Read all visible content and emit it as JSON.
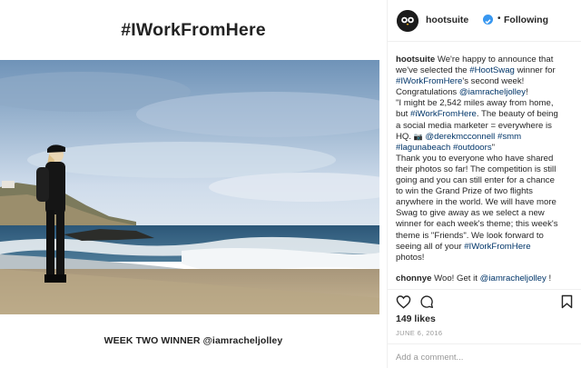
{
  "post_image": {
    "headline": "#IWorkFromHere",
    "caption_bottom": "WEEK TWO  WINNER @iamracheljolley"
  },
  "header": {
    "author": "hootsuite",
    "separator": "•",
    "following": "Following"
  },
  "caption": {
    "username": "hootsuite",
    "l1": "We're happy to announce that",
    "l2a": "we've selected the ",
    "l2tag": "#HootSwag",
    "l2b": " winner for",
    "l3tag": "#IWorkFromHere",
    "l3b": "'s second week!",
    "l4a": "Congratulations ",
    "l4tag": "@iamracheljolley",
    "l4b": "!",
    "l5": "\"I might be 2,542 miles away from home,",
    "l6a": "but ",
    "l6tag": "#iWorkFromHere",
    "l6b": ". The beauty of being",
    "l7": "a social media marketer = everywhere is",
    "l8a": "HQ. ",
    "l8emoji": "📷",
    "l8tag1": "@derekmcconnell",
    "l8tag2": "#smm",
    "l9tag1": "#lagunabeach",
    "l9tag2": "#outdoors",
    "l9b": "\"",
    "l10": "Thank you to everyone who have shared",
    "l11": "their photos so far! The competition is still",
    "l12": "going and you can still enter for a chance",
    "l13": "to win the Grand Prize of two flights",
    "l14": "anywhere in the world. We will have more",
    "l15": "Swag to give away as we select a new",
    "l16": "winner for each week's theme; this week's",
    "l17": "theme is \"Friends\". We look forward to",
    "l18a": "seeing all of your ",
    "l18tag": "#IWorkFromHere",
    "l19": "photos!"
  },
  "comment": {
    "username": "chonnye",
    "text": "Woo! Get it ",
    "mention": "@iamracheljolley",
    "end": " !"
  },
  "likes": "149 likes",
  "date": "JUNE 6, 2016",
  "add_comment_placeholder": "Add a comment...",
  "icons": {
    "heart": "heart-icon",
    "comment": "comment-icon",
    "bookmark": "bookmark-icon",
    "verified": "verified-badge-icon"
  },
  "colors": {
    "link": "#003569",
    "verified": "#3897f0",
    "muted": "#999999"
  }
}
